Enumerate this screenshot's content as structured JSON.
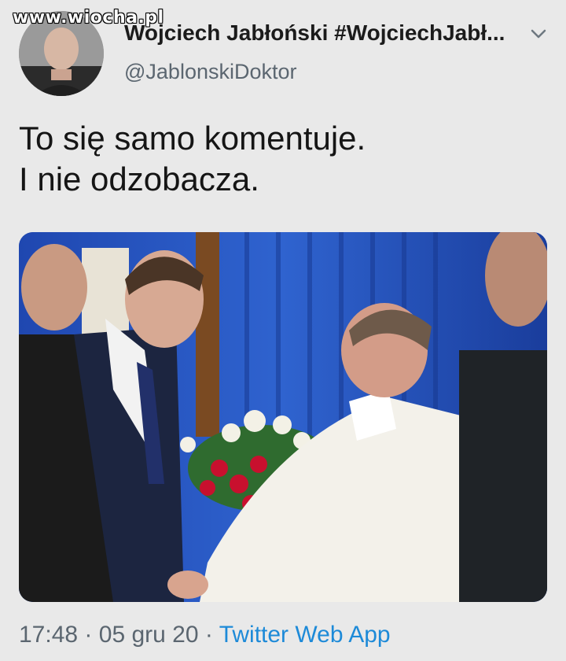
{
  "watermark": "www.wiocha.pl",
  "tweet": {
    "display_name": "Wojciech Jabłoński #WojciechJabł...",
    "handle": "@JablonskiDoktor",
    "text_lines": [
      "To się samo komentuje.",
      "I nie odzobacza."
    ],
    "time": "17:48",
    "separator": "·",
    "date": "05 gru 20",
    "source": "Twitter Web App"
  },
  "icons": {
    "more": "chevron-down-icon"
  },
  "colors": {
    "background": "#e9e9e9",
    "secondary_text": "#5b6670",
    "link": "#1d8ad8"
  }
}
